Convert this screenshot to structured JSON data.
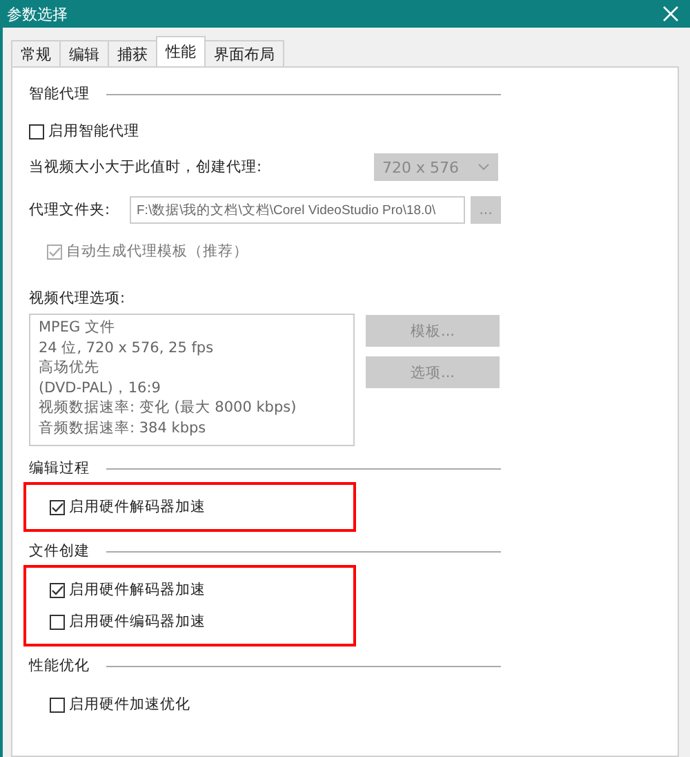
{
  "window": {
    "title": "参数选择"
  },
  "tabs": [
    {
      "label": "常规",
      "selected": false
    },
    {
      "label": "编辑",
      "selected": false
    },
    {
      "label": "捕获",
      "selected": false
    },
    {
      "label": "性能",
      "selected": true
    },
    {
      "label": "界面布局",
      "selected": false
    }
  ],
  "smart_proxy": {
    "heading": "智能代理",
    "enable": {
      "label": "启用智能代理",
      "checked": false
    },
    "size_label": "当视频大小大于此值时，创建代理:",
    "size_dropdown": {
      "value": "720 x 576",
      "disabled": true
    },
    "folder_label": "代理文件夹:",
    "folder_path": "F:\\数据\\我的文档\\文档\\Corel VideoStudio Pro\\18.0\\",
    "browse_button": {
      "label": "...",
      "disabled": true
    },
    "auto_template": {
      "label": "自动生成代理模板（推荐）",
      "checked": true,
      "disabled": true
    }
  },
  "video_options": {
    "label": "视频代理选项:",
    "lines": [
      "MPEG 文件",
      "24 位, 720 x 576, 25 fps",
      "高场优先",
      "(DVD-PAL)，16:9",
      "视频数据速率: 变化 (最大  8000 kbps)",
      "音频数据速率: 384 kbps"
    ],
    "buttons": [
      {
        "label": "模板...",
        "disabled": true
      },
      {
        "label": "选项...",
        "disabled": true
      }
    ]
  },
  "groups": [
    {
      "heading": "编辑过程",
      "highlighted": true,
      "options": [
        {
          "label": "启用硬件解码器加速",
          "checked": true
        }
      ]
    },
    {
      "heading": "文件创建",
      "highlighted": true,
      "options": [
        {
          "label": "启用硬件解码器加速",
          "checked": true
        },
        {
          "label": "启用硬件编码器加速",
          "checked": false
        }
      ]
    },
    {
      "heading": "性能优化",
      "highlighted": false,
      "options": [
        {
          "label": "启用硬件加速优化",
          "checked": false
        }
      ]
    }
  ]
}
